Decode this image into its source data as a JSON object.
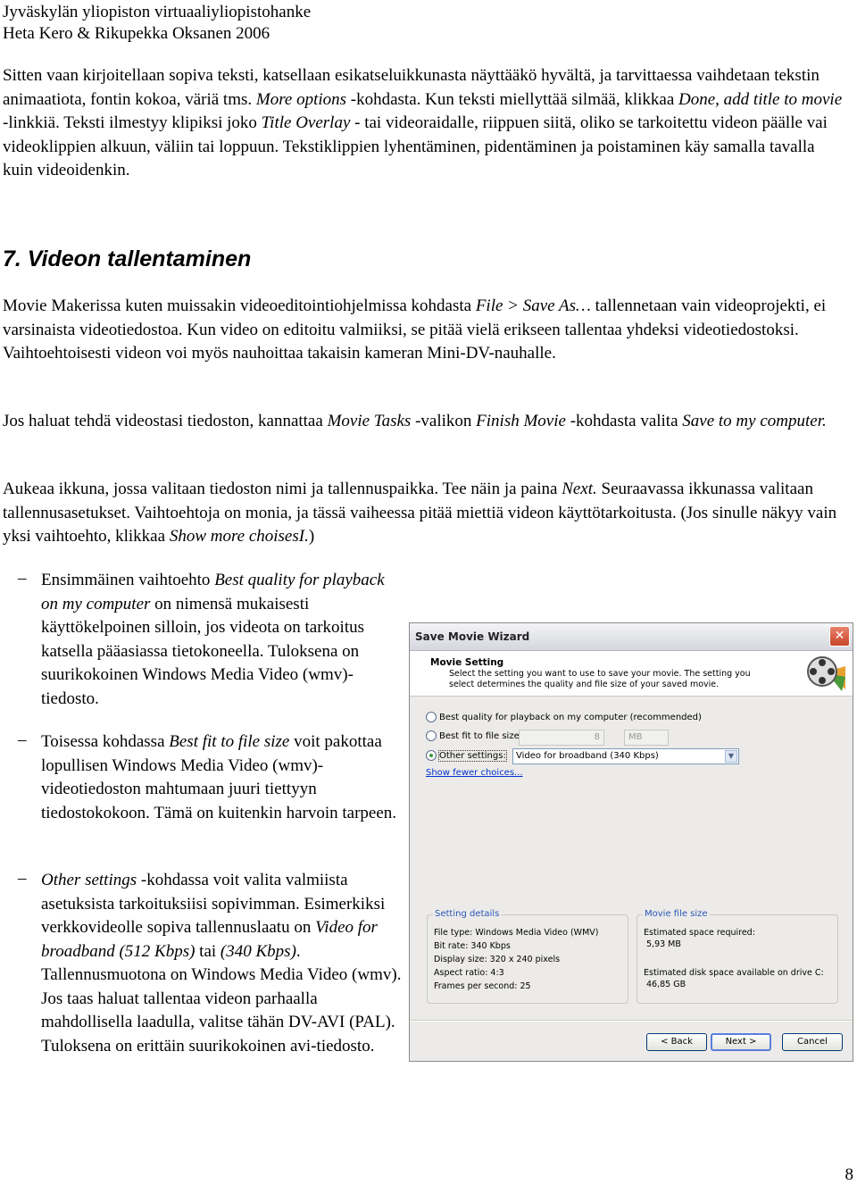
{
  "header": {
    "line1": "Jyväskylän yliopiston virtuaaliyliopistohanke",
    "line2": "Heta Kero & Rikupekka Oksanen 2006"
  },
  "paragraphs": [
    [
      {
        "t": "Sitten vaan kirjoitellaan sopiva teksti, katsellaan esikatseluikkunasta näyttääkö hyvältä, ja tarvittaessa vaihdetaan tekstin animaatiota, fontin kokoa, väriä tms. "
      },
      {
        "t": "More options",
        "i": true
      },
      {
        "t": " -kohdasta. Kun teksti miellyttää silmää, klikkaa "
      },
      {
        "t": "Done, add title to movie",
        "i": true
      },
      {
        "t": " -linkkiä. Teksti ilmestyy klipiksi joko "
      },
      {
        "t": "Title Overlay",
        "i": true
      },
      {
        "t": " - tai videoraidalle, riippuen siitä, oliko se tarkoitettu videon päälle vai videoklippien alkuun, väliin tai loppuun. Tekstiklippien lyhentäminen, pidentäminen ja poistaminen käy samalla tavalla kuin videoidenkin."
      }
    ],
    [
      {
        "t": "Movie Makerissa kuten muissakin videoeditointiohjelmissa kohdasta "
      },
      {
        "t": "File > Save As…",
        "i": true
      },
      {
        "t": " tallennetaan vain videoprojekti, ei varsinaista videotiedostoa. Kun video on editoitu valmiiksi, se pitää vielä erikseen tallentaa yhdeksi videotiedostoksi. Vaihtoehtoisesti videon voi myös nauhoittaa takaisin kameran Mini-DV-nauhalle."
      }
    ],
    [
      {
        "t": "Jos haluat tehdä videostasi tiedoston, kannattaa "
      },
      {
        "t": "Movie Tasks",
        "i": true
      },
      {
        "t": " -valikon "
      },
      {
        "t": "Finish Movie",
        "i": true
      },
      {
        "t": " -kohdasta valita "
      },
      {
        "t": "Save to my computer.",
        "i": true
      }
    ],
    [
      {
        "t": "Aukeaa ikkuna, jossa valitaan tiedoston nimi ja tallennuspaikka. Tee näin ja paina "
      },
      {
        "t": "Next.",
        "i": true
      },
      {
        "t": " Seuraavassa ikkunassa valitaan tallennusasetukset. Vaihtoehtoja on monia, ja tässä vaiheessa pitää miettiä videon käyttötarkoitusta. (Jos sinulle näkyy vain yksi vaihtoehto, klikkaa "
      },
      {
        "t": "Show more choisesI.",
        "i": true
      },
      {
        "t": ")"
      }
    ]
  ],
  "section_heading": "7.  Videon tallentaminen",
  "bullet_marker": "–",
  "bullets": [
    [
      {
        "t": "Ensimmäinen vaihtoehto "
      },
      {
        "t": "Best quality for playback on my computer",
        "i": true
      },
      {
        "t": " on nimensä mukaisesti käyttökelpoinen silloin, jos videota on tarkoitus katsella pääasiassa tietokoneella. Tuloksena on suurikokoinen Windows Media Video (wmv)-tiedosto."
      }
    ],
    [
      {
        "t": "Toisessa kohdassa "
      },
      {
        "t": "Best fit to file size",
        "i": true
      },
      {
        "t": " voit pakottaa lopullisen Windows Media Video (wmv)-videotiedoston mahtumaan juuri tiettyyn tiedostokokoon. Tämä on kuitenkin harvoin tarpeen."
      }
    ],
    [
      {
        "t": "Other settings",
        "i": true
      },
      {
        "t": " -kohdassa voit valita valmiista asetuksista tarkoituksiisi sopivimman. Esimerkiksi verkkovideolle sopiva tallennuslaatu on "
      },
      {
        "t": "Video for broadband (512 Kbps)",
        "i": true
      },
      {
        "t": " tai "
      },
      {
        "t": "(340 Kbps)",
        "i": true
      },
      {
        "t": ". Tallennusmuotona on Windows Media Video (wmv). Jos taas haluat tallentaa videon parhaalla mahdollisella laadulla, valitse tähän DV-AVI (PAL). Tuloksena on erittäin suurikokoinen avi-tiedosto."
      }
    ]
  ],
  "dialog": {
    "title": "Save Movie Wizard",
    "close": "✕",
    "heading": "Movie Setting",
    "subtitle": "Select the setting you want to use to save your movie. The setting you select determines the quality and file size of your saved movie.",
    "options": [
      {
        "label": "Best quality for playback on my computer (recommended)",
        "selected": false
      },
      {
        "label": "Best fit to file size:",
        "selected": false
      },
      {
        "label": "Other settings:",
        "selected": true
      }
    ],
    "file_size_value": "8",
    "file_size_unit": "MB",
    "other_settings_value": "Video for broadband (340 Kbps)",
    "show_fewer": "Show fewer choices...",
    "setting_details": {
      "title": "Setting details",
      "items": [
        "File type: Windows Media Video (WMV)",
        "Bit rate: 340 Kbps",
        "Display size: 320 x 240 pixels",
        "Aspect ratio: 4:3",
        "Frames per second: 25"
      ]
    },
    "movie_file_size": {
      "title": "Movie file size",
      "required_label": "Estimated space required:",
      "required_value": "5,93 MB",
      "available_label": "Estimated disk space available on drive C:",
      "available_value": "46,85 GB"
    },
    "buttons": {
      "back": "< Back",
      "next": "Next >",
      "cancel": "Cancel"
    }
  },
  "page_number": "8"
}
